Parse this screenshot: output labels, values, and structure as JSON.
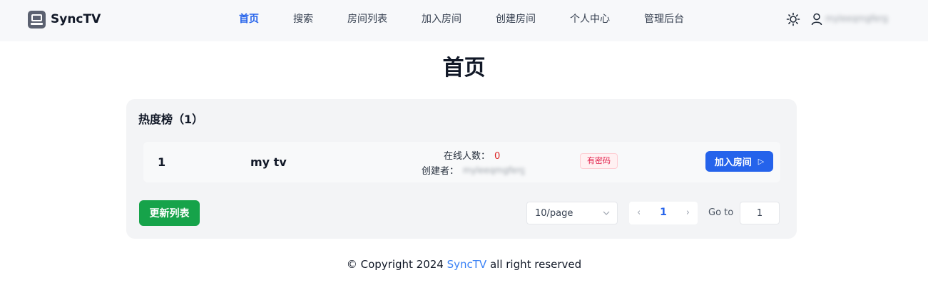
{
  "brand": {
    "name": "SyncTV"
  },
  "nav": {
    "items": [
      {
        "label": "首页",
        "active": true
      },
      {
        "label": "搜索"
      },
      {
        "label": "房间列表"
      },
      {
        "label": "加入房间"
      },
      {
        "label": "创建房间"
      },
      {
        "label": "个人中心"
      },
      {
        "label": "管理后台"
      }
    ]
  },
  "header": {
    "theme_icon": "sun-icon",
    "user_icon": "user-icon",
    "username": "myleeqmgferg"
  },
  "page": {
    "title": "首页"
  },
  "hot": {
    "title": "热度榜（1）",
    "rooms": [
      {
        "rank": "1",
        "name": "my tv",
        "online_label": "在线人数：",
        "online_count": "0",
        "creator_label": "创建者：",
        "creator_name": "myleeqmgferg",
        "tag": "有密码",
        "join_label": "加入房间",
        "join_icon": "▷"
      }
    ],
    "refresh_label": "更新列表",
    "pagination": {
      "page_size": "10/page",
      "prev_icon": "‹",
      "current_page": "1",
      "next_icon": "›",
      "goto_label": "Go to",
      "goto_value": "1"
    }
  },
  "footer": {
    "prefix": "© Copyright 2024 ",
    "link": "SyncTV",
    "suffix": " all right reserved"
  },
  "colors": {
    "accent": "#2563eb",
    "success": "#16a34a",
    "danger": "#dc2626"
  }
}
